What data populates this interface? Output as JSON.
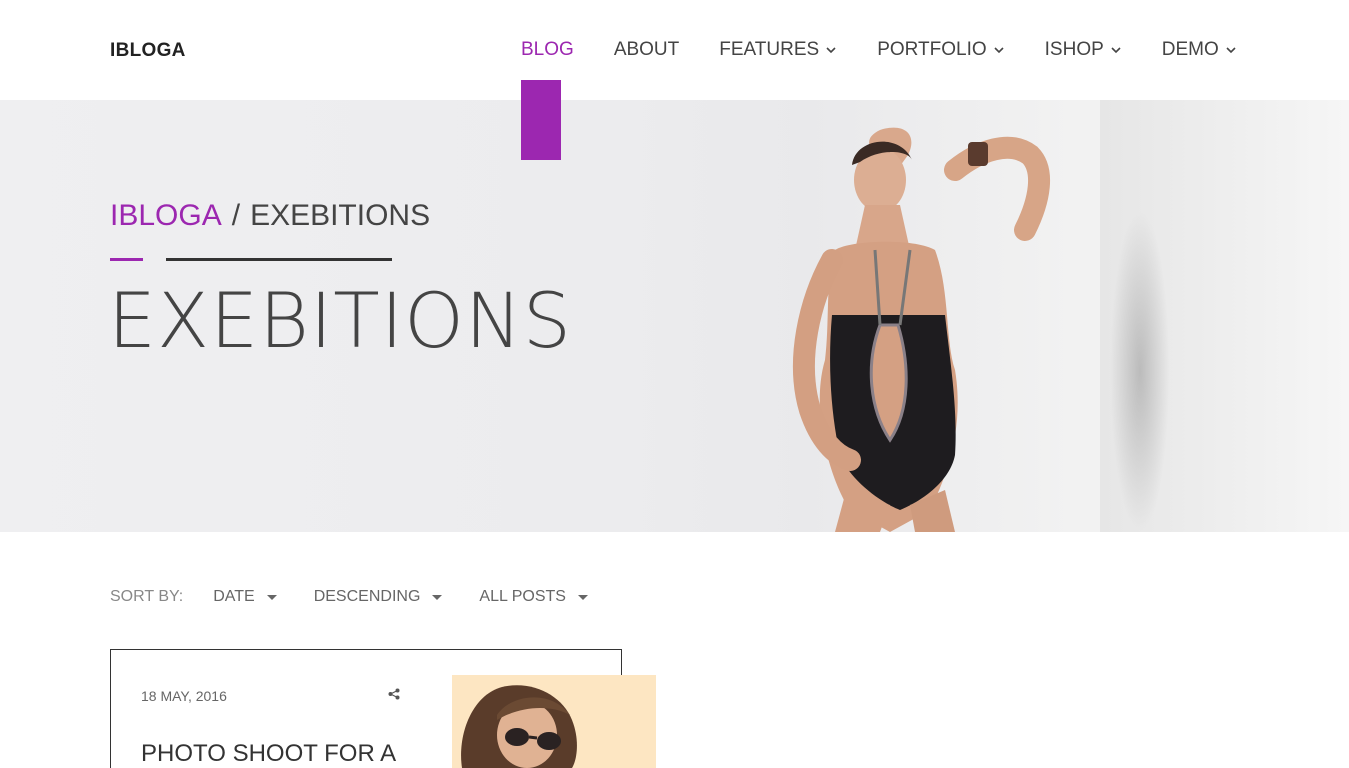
{
  "header": {
    "logo": "IBLOGA",
    "nav": [
      {
        "label": "BLOG",
        "active": true,
        "dropdown": false
      },
      {
        "label": "ABOUT",
        "active": false,
        "dropdown": false
      },
      {
        "label": "FEATURES",
        "active": false,
        "dropdown": true
      },
      {
        "label": "PORTFOLIO",
        "active": false,
        "dropdown": true
      },
      {
        "label": "ISHOP",
        "active": false,
        "dropdown": true
      },
      {
        "label": "DEMO",
        "active": false,
        "dropdown": true
      }
    ]
  },
  "hero": {
    "breadcrumb_home": "IBLOGA",
    "breadcrumb_sep": "/",
    "breadcrumb_current": "EXEBITIONS",
    "title": "EXEBITIONS"
  },
  "sort": {
    "label": "SORT BY:",
    "options": [
      "DATE",
      "DESCENDING",
      "ALL POSTS"
    ]
  },
  "post": {
    "date": "18 MAY, 2016",
    "title": "PHOTO SHOOT FOR A",
    "share_icon": "share-icon"
  },
  "colors": {
    "accent": "#9c27b0",
    "text": "#444444"
  }
}
